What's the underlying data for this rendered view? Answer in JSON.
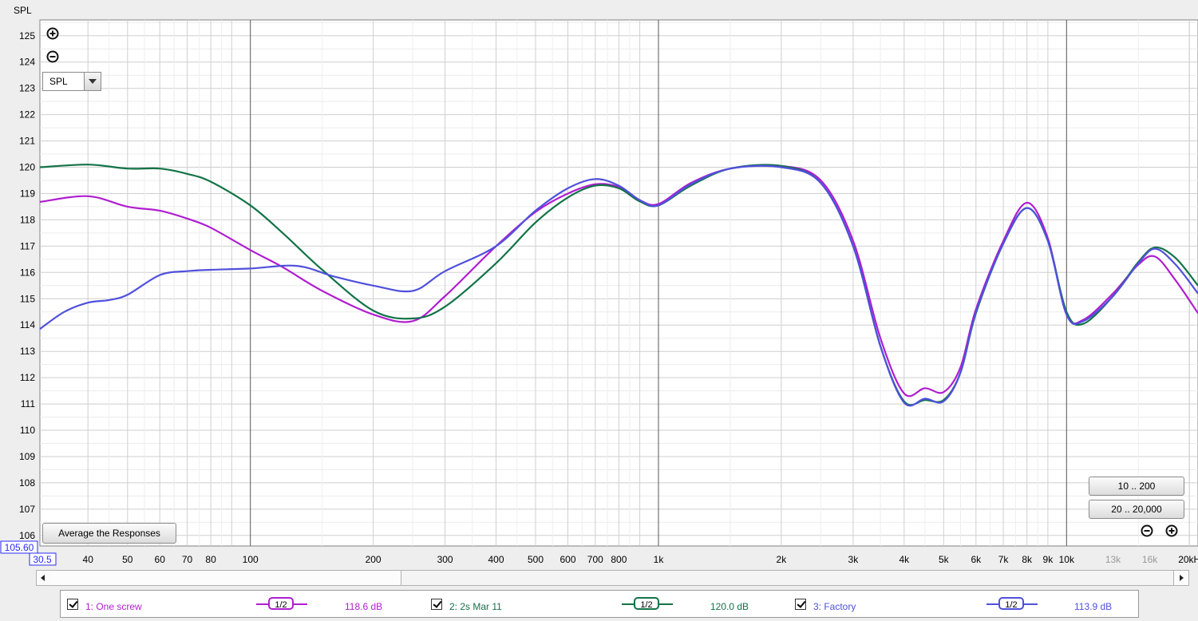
{
  "chart_data": {
    "type": "line",
    "xscale": "log",
    "xlim": [
      30.5,
      21000
    ],
    "ylim": [
      105.6,
      125.6
    ],
    "ylabel": "SPL",
    "x_ticks": [
      {
        "v": 40,
        "label": "40"
      },
      {
        "v": 50,
        "label": "50"
      },
      {
        "v": 60,
        "label": "60"
      },
      {
        "v": 70,
        "label": "70"
      },
      {
        "v": 80,
        "label": "80"
      },
      {
        "v": 100,
        "label": "100"
      },
      {
        "v": 200,
        "label": "200"
      },
      {
        "v": 300,
        "label": "300"
      },
      {
        "v": 400,
        "label": "400"
      },
      {
        "v": 500,
        "label": "500"
      },
      {
        "v": 600,
        "label": "600"
      },
      {
        "v": 700,
        "label": "700"
      },
      {
        "v": 800,
        "label": "800"
      },
      {
        "v": 1000,
        "label": "1k"
      },
      {
        "v": 2000,
        "label": "2k"
      },
      {
        "v": 3000,
        "label": "3k"
      },
      {
        "v": 4000,
        "label": "4k"
      },
      {
        "v": 5000,
        "label": "5k"
      },
      {
        "v": 6000,
        "label": "6k"
      },
      {
        "v": 7000,
        "label": "7k"
      },
      {
        "v": 8000,
        "label": "8k"
      },
      {
        "v": 9000,
        "label": "9k"
      },
      {
        "v": 10000,
        "label": "10k"
      },
      {
        "v": 13000,
        "label": "13k",
        "dim": true
      },
      {
        "v": 16000,
        "label": "16k",
        "dim": true
      },
      {
        "v": 20000,
        "label": "20kHz"
      }
    ],
    "y_ticks": [
      106,
      107,
      108,
      109,
      110,
      111,
      112,
      113,
      114,
      115,
      116,
      117,
      118,
      119,
      120,
      121,
      122,
      123,
      124,
      125
    ],
    "x_min_label": "30.5",
    "y_min_label": "105.60",
    "grid": true,
    "series": [
      {
        "name": "1: One screw",
        "color": "#b01ed0",
        "points": [
          [
            30.5,
            118.68
          ],
          [
            40,
            118.9
          ],
          [
            50,
            118.5
          ],
          [
            60,
            118.35
          ],
          [
            70,
            118.05
          ],
          [
            80,
            117.7
          ],
          [
            100,
            116.85
          ],
          [
            120,
            116.2
          ],
          [
            150,
            115.3
          ],
          [
            200,
            114.4
          ],
          [
            250,
            114.15
          ],
          [
            300,
            115.1
          ],
          [
            400,
            117.0
          ],
          [
            500,
            118.3
          ],
          [
            600,
            119.0
          ],
          [
            700,
            119.35
          ],
          [
            800,
            119.25
          ],
          [
            900,
            118.75
          ],
          [
            1000,
            118.6
          ],
          [
            1200,
            119.4
          ],
          [
            1500,
            119.95
          ],
          [
            2000,
            120.05
          ],
          [
            2500,
            119.5
          ],
          [
            3000,
            117.2
          ],
          [
            3500,
            113.5
          ],
          [
            4000,
            111.4
          ],
          [
            4500,
            111.6
          ],
          [
            5000,
            111.45
          ],
          [
            5500,
            112.4
          ],
          [
            6000,
            114.6
          ],
          [
            7000,
            117.2
          ],
          [
            8000,
            118.65
          ],
          [
            9000,
            117.3
          ],
          [
            10000,
            114.4
          ],
          [
            11000,
            114.2
          ],
          [
            13000,
            115.2
          ],
          [
            15000,
            116.3
          ],
          [
            16500,
            116.6
          ],
          [
            18500,
            115.7
          ],
          [
            21000,
            114.45
          ]
        ]
      },
      {
        "name": "2: 2s Mar 11",
        "color": "#137348",
        "points": [
          [
            30.5,
            120.0
          ],
          [
            40,
            120.1
          ],
          [
            50,
            119.95
          ],
          [
            60,
            119.95
          ],
          [
            70,
            119.75
          ],
          [
            80,
            119.45
          ],
          [
            100,
            118.55
          ],
          [
            120,
            117.5
          ],
          [
            150,
            116.1
          ],
          [
            200,
            114.55
          ],
          [
            250,
            114.25
          ],
          [
            300,
            114.7
          ],
          [
            400,
            116.35
          ],
          [
            500,
            117.9
          ],
          [
            600,
            118.85
          ],
          [
            700,
            119.3
          ],
          [
            800,
            119.2
          ],
          [
            900,
            118.7
          ],
          [
            1000,
            118.55
          ],
          [
            1200,
            119.3
          ],
          [
            1500,
            119.95
          ],
          [
            2000,
            120.05
          ],
          [
            2500,
            119.4
          ],
          [
            3000,
            117.0
          ],
          [
            3500,
            113.2
          ],
          [
            4000,
            111.1
          ],
          [
            4500,
            111.15
          ],
          [
            5000,
            111.15
          ],
          [
            5500,
            112.2
          ],
          [
            6000,
            114.45
          ],
          [
            7000,
            117.1
          ],
          [
            8000,
            118.45
          ],
          [
            9000,
            117.2
          ],
          [
            10000,
            114.5
          ],
          [
            11000,
            114.05
          ],
          [
            13000,
            115.1
          ],
          [
            15000,
            116.4
          ],
          [
            16500,
            116.95
          ],
          [
            18500,
            116.55
          ],
          [
            21000,
            115.5
          ]
        ]
      },
      {
        "name": "3: Factory",
        "color": "#5050dd",
        "points": [
          [
            30.5,
            113.85
          ],
          [
            35,
            114.5
          ],
          [
            40,
            114.85
          ],
          [
            45,
            114.95
          ],
          [
            50,
            115.15
          ],
          [
            60,
            115.9
          ],
          [
            70,
            116.05
          ],
          [
            80,
            116.1
          ],
          [
            100,
            116.15
          ],
          [
            130,
            116.25
          ],
          [
            160,
            115.85
          ],
          [
            200,
            115.5
          ],
          [
            250,
            115.3
          ],
          [
            300,
            116.05
          ],
          [
            400,
            117.0
          ],
          [
            500,
            118.35
          ],
          [
            600,
            119.2
          ],
          [
            700,
            119.55
          ],
          [
            800,
            119.3
          ],
          [
            900,
            118.75
          ],
          [
            1000,
            118.55
          ],
          [
            1200,
            119.35
          ],
          [
            1500,
            119.95
          ],
          [
            2000,
            120.0
          ],
          [
            2500,
            119.4
          ],
          [
            3000,
            117.0
          ],
          [
            3500,
            113.2
          ],
          [
            4000,
            111.05
          ],
          [
            4500,
            111.2
          ],
          [
            5000,
            111.1
          ],
          [
            5500,
            112.2
          ],
          [
            6000,
            114.5
          ],
          [
            7000,
            117.1
          ],
          [
            8000,
            118.45
          ],
          [
            9000,
            117.2
          ],
          [
            10000,
            114.4
          ],
          [
            11000,
            114.15
          ],
          [
            13000,
            115.1
          ],
          [
            15000,
            116.35
          ],
          [
            16500,
            116.9
          ],
          [
            18500,
            116.3
          ],
          [
            21000,
            115.2
          ]
        ]
      }
    ]
  },
  "controls": {
    "spl_dropdown_value": "SPL",
    "average_button_label": "Average the Responses",
    "range_button_1": "10 .. 200",
    "range_button_2": "20 .. 20,000"
  },
  "legend": {
    "items": [
      {
        "label": "1: One screw",
        "smoothing": "1/2",
        "level": "118.6 dB",
        "color": "#b01ed0"
      },
      {
        "label": "2: 2s Mar 11",
        "smoothing": "1/2",
        "level": "120.0 dB",
        "color": "#137348"
      },
      {
        "label": "3: Factory",
        "smoothing": "1/2",
        "level": "113.9 dB",
        "color": "#5050dd"
      }
    ]
  }
}
